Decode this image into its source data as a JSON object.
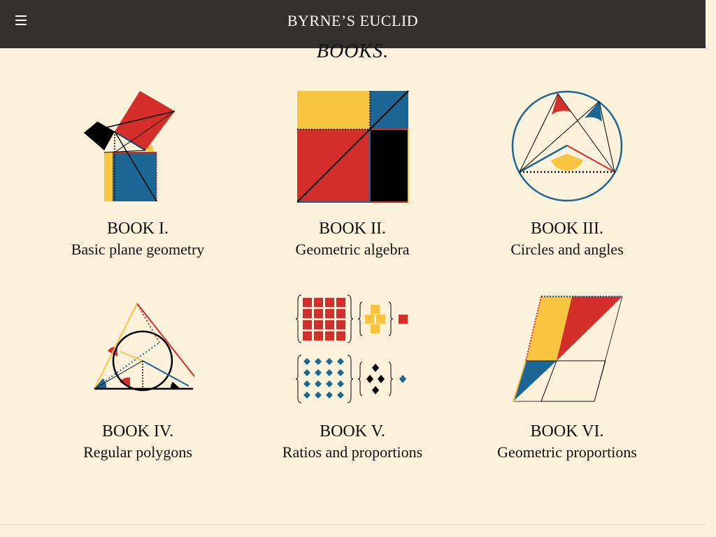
{
  "header": {
    "menu_icon": "hamburger-icon",
    "title": "BYRNE’S EUCLID"
  },
  "section": {
    "title": "BOOKS."
  },
  "books": [
    {
      "number": "BOOK I.",
      "subtitle": "Basic plane geometry"
    },
    {
      "number": "BOOK II.",
      "subtitle": "Geometric algebra"
    },
    {
      "number": "BOOK III.",
      "subtitle": "Circles and angles"
    },
    {
      "number": "BOOK IV.",
      "subtitle": "Regular polygons"
    },
    {
      "number": "BOOK V.",
      "subtitle": "Ratios and proportions"
    },
    {
      "number": "BOOK VI.",
      "subtitle": "Geometric proportions"
    }
  ],
  "colors": {
    "background": "#fcf2dc",
    "header": "#31302c",
    "red": "#d42e2a",
    "yellow": "#f9c440",
    "blue": "#1c6696",
    "black": "#000000"
  }
}
